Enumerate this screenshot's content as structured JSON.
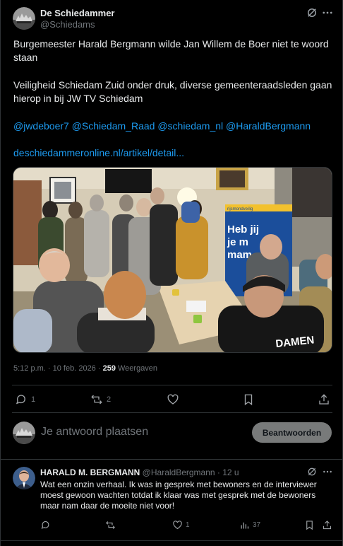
{
  "post": {
    "author_name": "De Schiedammer",
    "author_handle": "@Schiedams",
    "headline": "Burgemeester Harald Bergmann wilde Jan Willem de Boer niet te woord staan",
    "body": "Veiligheid Schiedam Zuid onder druk, diverse gemeenteraadsleden gaan hierop in bij JW TV Schiedam",
    "mentions": [
      "@jwdeboer7",
      "@Schiedam_Raad",
      "@schiedam_nl",
      "@HaraldBergmann"
    ],
    "link": "deschiedammeronline.nl/artikel/detail...",
    "time": "5:12 p.m. · 10 feb. 2026 · ",
    "views_count": "259",
    "views_label": " Weergaven",
    "photo": {
      "banner_top": "rijsmondveilig",
      "banner_text": "Heb jij\nje m\nmam\nam",
      "shirt_text": "DAMEN"
    },
    "actions": {
      "reply_count": "1",
      "repost_count": "2",
      "like_count": "",
      "bookmark_count": ""
    }
  },
  "composer": {
    "placeholder": "Je antwoord plaatsen",
    "button_label": "Beantwoorden"
  },
  "reply": {
    "author_name": "HARALD M. BERGMANN",
    "author_handle": "@HaraldBergmann",
    "time": "· 12 u",
    "text": "Wat een onzin verhaal. Ik was in gesprek met bewoners en de interviewer moest gewoon wachten totdat ik klaar was met gesprek met de bewoners maar nam daar de moeite niet voor!",
    "actions": {
      "reply_count": "",
      "repost_count": "",
      "like_count": "1",
      "views_count": "37"
    }
  },
  "colors": {
    "background": "#000000",
    "text": "#e7e9ea",
    "muted": "#71767b",
    "link": "#1d9bf0",
    "divider": "#2f3336",
    "button": "#787a7a"
  },
  "icons": [
    "grok-icon",
    "more-icon",
    "reply-icon",
    "repost-icon",
    "like-icon",
    "bookmark-icon",
    "share-icon",
    "views-icon"
  ]
}
